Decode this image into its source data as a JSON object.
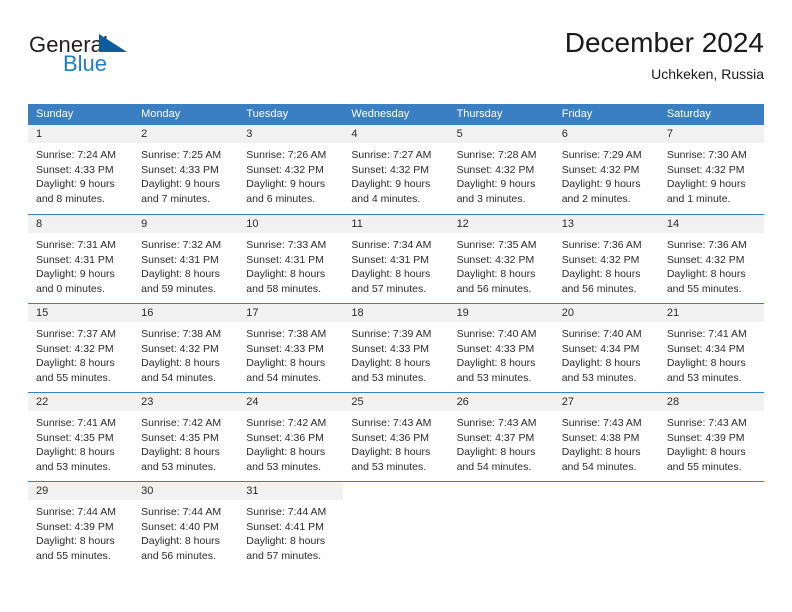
{
  "brand": {
    "name_part1": "General",
    "name_part2": "Blue",
    "logo_icon": "triangle-logo-icon"
  },
  "header": {
    "title": "December 2024",
    "subtitle": "Uchkeken, Russia"
  },
  "calendar": {
    "weekdays": [
      "Sunday",
      "Monday",
      "Tuesday",
      "Wednesday",
      "Thursday",
      "Friday",
      "Saturday"
    ],
    "accent_color": "#3a7fc1",
    "day_number_bg": "#f1f1f1",
    "weeks": [
      [
        {
          "day": "1",
          "sunrise": "Sunrise: 7:24 AM",
          "sunset": "Sunset: 4:33 PM",
          "daylight1": "Daylight: 9 hours",
          "daylight2": "and 8 minutes."
        },
        {
          "day": "2",
          "sunrise": "Sunrise: 7:25 AM",
          "sunset": "Sunset: 4:33 PM",
          "daylight1": "Daylight: 9 hours",
          "daylight2": "and 7 minutes."
        },
        {
          "day": "3",
          "sunrise": "Sunrise: 7:26 AM",
          "sunset": "Sunset: 4:32 PM",
          "daylight1": "Daylight: 9 hours",
          "daylight2": "and 6 minutes."
        },
        {
          "day": "4",
          "sunrise": "Sunrise: 7:27 AM",
          "sunset": "Sunset: 4:32 PM",
          "daylight1": "Daylight: 9 hours",
          "daylight2": "and 4 minutes."
        },
        {
          "day": "5",
          "sunrise": "Sunrise: 7:28 AM",
          "sunset": "Sunset: 4:32 PM",
          "daylight1": "Daylight: 9 hours",
          "daylight2": "and 3 minutes."
        },
        {
          "day": "6",
          "sunrise": "Sunrise: 7:29 AM",
          "sunset": "Sunset: 4:32 PM",
          "daylight1": "Daylight: 9 hours",
          "daylight2": "and 2 minutes."
        },
        {
          "day": "7",
          "sunrise": "Sunrise: 7:30 AM",
          "sunset": "Sunset: 4:32 PM",
          "daylight1": "Daylight: 9 hours",
          "daylight2": "and 1 minute."
        }
      ],
      [
        {
          "day": "8",
          "sunrise": "Sunrise: 7:31 AM",
          "sunset": "Sunset: 4:31 PM",
          "daylight1": "Daylight: 9 hours",
          "daylight2": "and 0 minutes."
        },
        {
          "day": "9",
          "sunrise": "Sunrise: 7:32 AM",
          "sunset": "Sunset: 4:31 PM",
          "daylight1": "Daylight: 8 hours",
          "daylight2": "and 59 minutes."
        },
        {
          "day": "10",
          "sunrise": "Sunrise: 7:33 AM",
          "sunset": "Sunset: 4:31 PM",
          "daylight1": "Daylight: 8 hours",
          "daylight2": "and 58 minutes."
        },
        {
          "day": "11",
          "sunrise": "Sunrise: 7:34 AM",
          "sunset": "Sunset: 4:31 PM",
          "daylight1": "Daylight: 8 hours",
          "daylight2": "and 57 minutes."
        },
        {
          "day": "12",
          "sunrise": "Sunrise: 7:35 AM",
          "sunset": "Sunset: 4:32 PM",
          "daylight1": "Daylight: 8 hours",
          "daylight2": "and 56 minutes."
        },
        {
          "day": "13",
          "sunrise": "Sunrise: 7:36 AM",
          "sunset": "Sunset: 4:32 PM",
          "daylight1": "Daylight: 8 hours",
          "daylight2": "and 56 minutes."
        },
        {
          "day": "14",
          "sunrise": "Sunrise: 7:36 AM",
          "sunset": "Sunset: 4:32 PM",
          "daylight1": "Daylight: 8 hours",
          "daylight2": "and 55 minutes."
        }
      ],
      [
        {
          "day": "15",
          "sunrise": "Sunrise: 7:37 AM",
          "sunset": "Sunset: 4:32 PM",
          "daylight1": "Daylight: 8 hours",
          "daylight2": "and 55 minutes."
        },
        {
          "day": "16",
          "sunrise": "Sunrise: 7:38 AM",
          "sunset": "Sunset: 4:32 PM",
          "daylight1": "Daylight: 8 hours",
          "daylight2": "and 54 minutes."
        },
        {
          "day": "17",
          "sunrise": "Sunrise: 7:38 AM",
          "sunset": "Sunset: 4:33 PM",
          "daylight1": "Daylight: 8 hours",
          "daylight2": "and 54 minutes."
        },
        {
          "day": "18",
          "sunrise": "Sunrise: 7:39 AM",
          "sunset": "Sunset: 4:33 PM",
          "daylight1": "Daylight: 8 hours",
          "daylight2": "and 53 minutes."
        },
        {
          "day": "19",
          "sunrise": "Sunrise: 7:40 AM",
          "sunset": "Sunset: 4:33 PM",
          "daylight1": "Daylight: 8 hours",
          "daylight2": "and 53 minutes."
        },
        {
          "day": "20",
          "sunrise": "Sunrise: 7:40 AM",
          "sunset": "Sunset: 4:34 PM",
          "daylight1": "Daylight: 8 hours",
          "daylight2": "and 53 minutes."
        },
        {
          "day": "21",
          "sunrise": "Sunrise: 7:41 AM",
          "sunset": "Sunset: 4:34 PM",
          "daylight1": "Daylight: 8 hours",
          "daylight2": "and 53 minutes."
        }
      ],
      [
        {
          "day": "22",
          "sunrise": "Sunrise: 7:41 AM",
          "sunset": "Sunset: 4:35 PM",
          "daylight1": "Daylight: 8 hours",
          "daylight2": "and 53 minutes."
        },
        {
          "day": "23",
          "sunrise": "Sunrise: 7:42 AM",
          "sunset": "Sunset: 4:35 PM",
          "daylight1": "Daylight: 8 hours",
          "daylight2": "and 53 minutes."
        },
        {
          "day": "24",
          "sunrise": "Sunrise: 7:42 AM",
          "sunset": "Sunset: 4:36 PM",
          "daylight1": "Daylight: 8 hours",
          "daylight2": "and 53 minutes."
        },
        {
          "day": "25",
          "sunrise": "Sunrise: 7:43 AM",
          "sunset": "Sunset: 4:36 PM",
          "daylight1": "Daylight: 8 hours",
          "daylight2": "and 53 minutes."
        },
        {
          "day": "26",
          "sunrise": "Sunrise: 7:43 AM",
          "sunset": "Sunset: 4:37 PM",
          "daylight1": "Daylight: 8 hours",
          "daylight2": "and 54 minutes."
        },
        {
          "day": "27",
          "sunrise": "Sunrise: 7:43 AM",
          "sunset": "Sunset: 4:38 PM",
          "daylight1": "Daylight: 8 hours",
          "daylight2": "and 54 minutes."
        },
        {
          "day": "28",
          "sunrise": "Sunrise: 7:43 AM",
          "sunset": "Sunset: 4:39 PM",
          "daylight1": "Daylight: 8 hours",
          "daylight2": "and 55 minutes."
        }
      ],
      [
        {
          "day": "29",
          "sunrise": "Sunrise: 7:44 AM",
          "sunset": "Sunset: 4:39 PM",
          "daylight1": "Daylight: 8 hours",
          "daylight2": "and 55 minutes."
        },
        {
          "day": "30",
          "sunrise": "Sunrise: 7:44 AM",
          "sunset": "Sunset: 4:40 PM",
          "daylight1": "Daylight: 8 hours",
          "daylight2": "and 56 minutes."
        },
        {
          "day": "31",
          "sunrise": "Sunrise: 7:44 AM",
          "sunset": "Sunset: 4:41 PM",
          "daylight1": "Daylight: 8 hours",
          "daylight2": "and 57 minutes."
        },
        {
          "day": "",
          "sunrise": "",
          "sunset": "",
          "daylight1": "",
          "daylight2": ""
        },
        {
          "day": "",
          "sunrise": "",
          "sunset": "",
          "daylight1": "",
          "daylight2": ""
        },
        {
          "day": "",
          "sunrise": "",
          "sunset": "",
          "daylight1": "",
          "daylight2": ""
        },
        {
          "day": "",
          "sunrise": "",
          "sunset": "",
          "daylight1": "",
          "daylight2": ""
        }
      ]
    ]
  }
}
